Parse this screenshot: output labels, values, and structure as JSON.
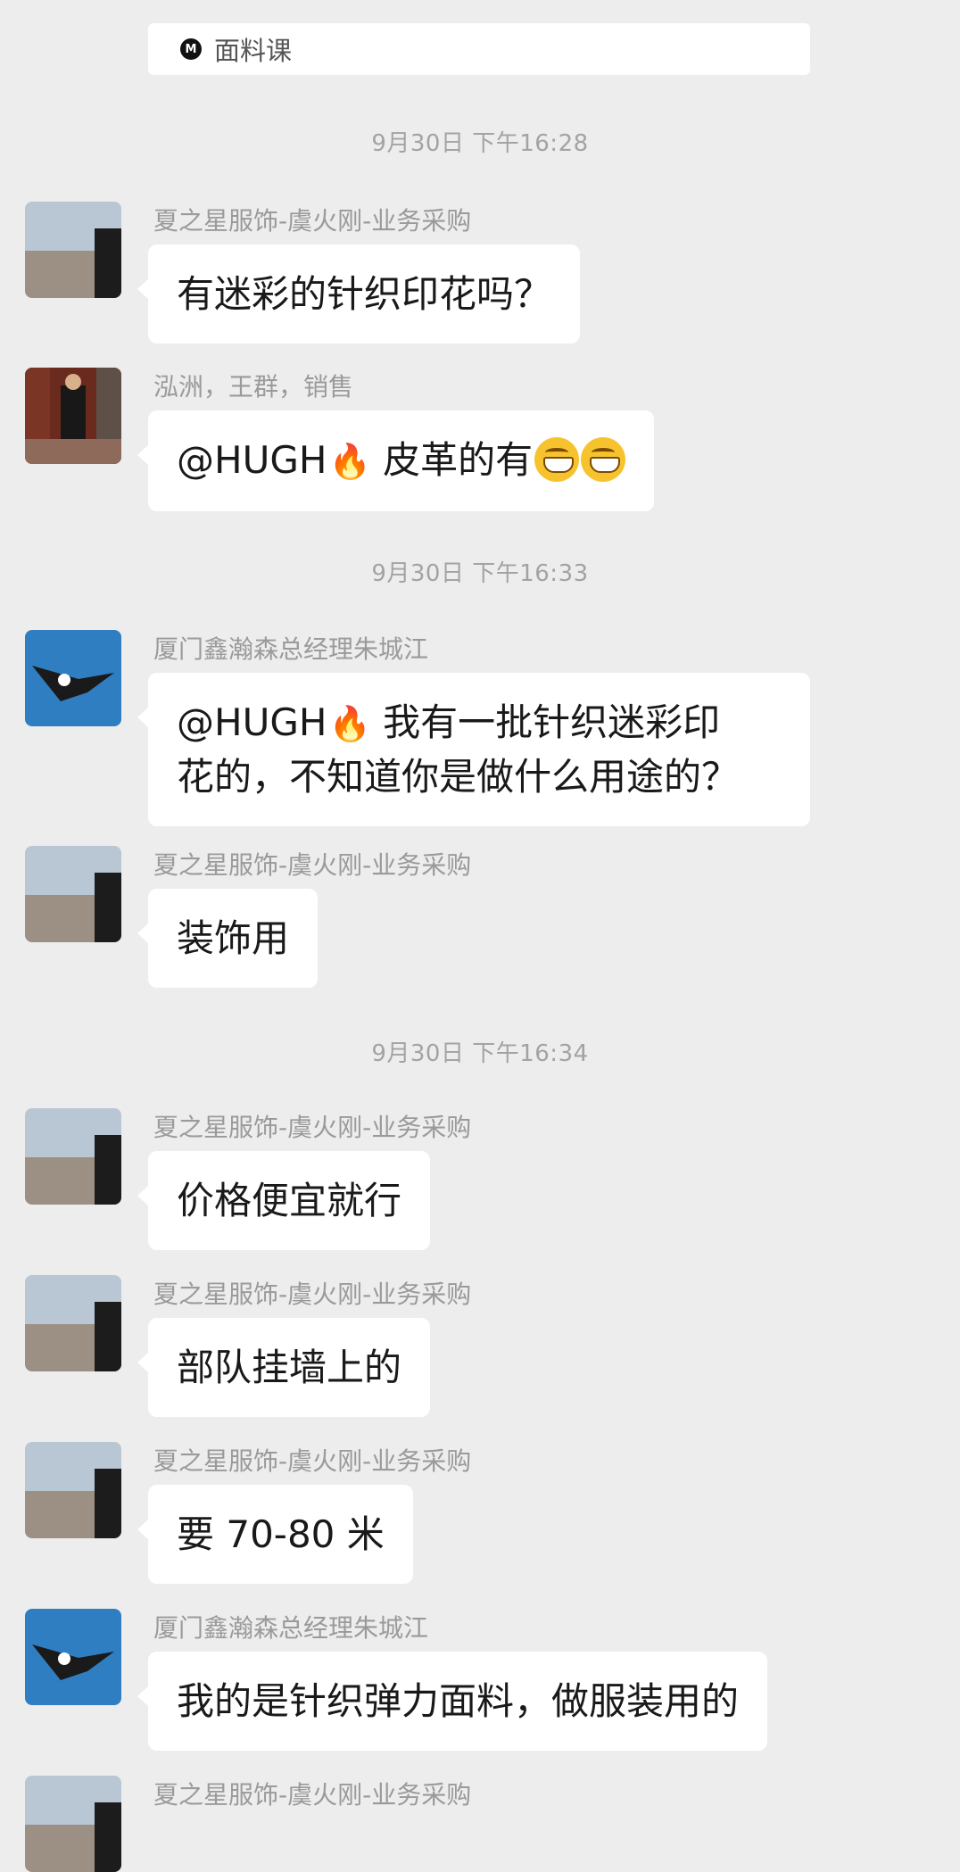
{
  "top_card": {
    "logo_text": "M",
    "title": "面料课"
  },
  "timestamps": [
    "9月30日 下午16:28",
    "9月30日 下午16:33",
    "9月30日 下午16:34"
  ],
  "messages": [
    {
      "sender": "夏之星服饰-虞火刚-业务采购",
      "text": "有迷彩的针织印花吗？"
    },
    {
      "sender": "泓洲，王群，销售",
      "mention": "@HUGH",
      "fire": "🔥",
      "text": " 皮革的有"
    },
    {
      "sender": "厦门鑫瀚森总经理朱城江",
      "mention": "@HUGH",
      "fire": "🔥",
      "line1": " 我有一批针织迷彩印",
      "line2": "花的，不知道你是做什么用途的？"
    },
    {
      "sender": "夏之星服饰-虞火刚-业务采购",
      "text": "装饰用"
    },
    {
      "sender": "夏之星服饰-虞火刚-业务采购",
      "text": "价格便宜就行"
    },
    {
      "sender": "夏之星服饰-虞火刚-业务采购",
      "text": "部队挂墙上的"
    },
    {
      "sender": "夏之星服饰-虞火刚-业务采购",
      "text": "要 70-80 米"
    },
    {
      "sender": "厦门鑫瀚森总经理朱城江",
      "text": "我的是针织弹力面料，做服装用的"
    },
    {
      "sender": "夏之星服饰-虞火刚-业务采购"
    }
  ],
  "colors": {
    "background": "#ededed",
    "bubble": "#ffffff",
    "sender_text": "#9a9a9a",
    "timestamp_text": "#a3a3a3"
  }
}
